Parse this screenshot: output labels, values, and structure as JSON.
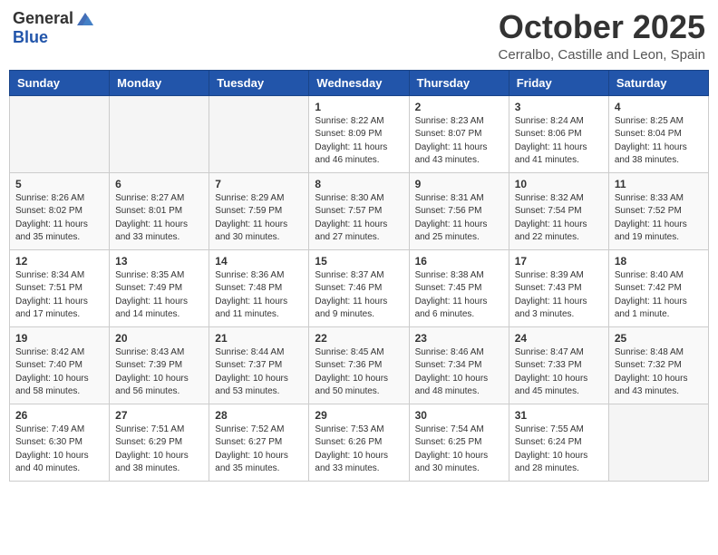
{
  "logo": {
    "text_general": "General",
    "text_blue": "Blue"
  },
  "header": {
    "month": "October 2025",
    "location": "Cerralbo, Castille and Leon, Spain"
  },
  "weekdays": [
    "Sunday",
    "Monday",
    "Tuesday",
    "Wednesday",
    "Thursday",
    "Friday",
    "Saturday"
  ],
  "weeks": [
    [
      {
        "day": "",
        "sunrise": "",
        "sunset": "",
        "daylight": ""
      },
      {
        "day": "",
        "sunrise": "",
        "sunset": "",
        "daylight": ""
      },
      {
        "day": "",
        "sunrise": "",
        "sunset": "",
        "daylight": ""
      },
      {
        "day": "1",
        "sunrise": "Sunrise: 8:22 AM",
        "sunset": "Sunset: 8:09 PM",
        "daylight": "Daylight: 11 hours and 46 minutes."
      },
      {
        "day": "2",
        "sunrise": "Sunrise: 8:23 AM",
        "sunset": "Sunset: 8:07 PM",
        "daylight": "Daylight: 11 hours and 43 minutes."
      },
      {
        "day": "3",
        "sunrise": "Sunrise: 8:24 AM",
        "sunset": "Sunset: 8:06 PM",
        "daylight": "Daylight: 11 hours and 41 minutes."
      },
      {
        "day": "4",
        "sunrise": "Sunrise: 8:25 AM",
        "sunset": "Sunset: 8:04 PM",
        "daylight": "Daylight: 11 hours and 38 minutes."
      }
    ],
    [
      {
        "day": "5",
        "sunrise": "Sunrise: 8:26 AM",
        "sunset": "Sunset: 8:02 PM",
        "daylight": "Daylight: 11 hours and 35 minutes."
      },
      {
        "day": "6",
        "sunrise": "Sunrise: 8:27 AM",
        "sunset": "Sunset: 8:01 PM",
        "daylight": "Daylight: 11 hours and 33 minutes."
      },
      {
        "day": "7",
        "sunrise": "Sunrise: 8:29 AM",
        "sunset": "Sunset: 7:59 PM",
        "daylight": "Daylight: 11 hours and 30 minutes."
      },
      {
        "day": "8",
        "sunrise": "Sunrise: 8:30 AM",
        "sunset": "Sunset: 7:57 PM",
        "daylight": "Daylight: 11 hours and 27 minutes."
      },
      {
        "day": "9",
        "sunrise": "Sunrise: 8:31 AM",
        "sunset": "Sunset: 7:56 PM",
        "daylight": "Daylight: 11 hours and 25 minutes."
      },
      {
        "day": "10",
        "sunrise": "Sunrise: 8:32 AM",
        "sunset": "Sunset: 7:54 PM",
        "daylight": "Daylight: 11 hours and 22 minutes."
      },
      {
        "day": "11",
        "sunrise": "Sunrise: 8:33 AM",
        "sunset": "Sunset: 7:52 PM",
        "daylight": "Daylight: 11 hours and 19 minutes."
      }
    ],
    [
      {
        "day": "12",
        "sunrise": "Sunrise: 8:34 AM",
        "sunset": "Sunset: 7:51 PM",
        "daylight": "Daylight: 11 hours and 17 minutes."
      },
      {
        "day": "13",
        "sunrise": "Sunrise: 8:35 AM",
        "sunset": "Sunset: 7:49 PM",
        "daylight": "Daylight: 11 hours and 14 minutes."
      },
      {
        "day": "14",
        "sunrise": "Sunrise: 8:36 AM",
        "sunset": "Sunset: 7:48 PM",
        "daylight": "Daylight: 11 hours and 11 minutes."
      },
      {
        "day": "15",
        "sunrise": "Sunrise: 8:37 AM",
        "sunset": "Sunset: 7:46 PM",
        "daylight": "Daylight: 11 hours and 9 minutes."
      },
      {
        "day": "16",
        "sunrise": "Sunrise: 8:38 AM",
        "sunset": "Sunset: 7:45 PM",
        "daylight": "Daylight: 11 hours and 6 minutes."
      },
      {
        "day": "17",
        "sunrise": "Sunrise: 8:39 AM",
        "sunset": "Sunset: 7:43 PM",
        "daylight": "Daylight: 11 hours and 3 minutes."
      },
      {
        "day": "18",
        "sunrise": "Sunrise: 8:40 AM",
        "sunset": "Sunset: 7:42 PM",
        "daylight": "Daylight: 11 hours and 1 minute."
      }
    ],
    [
      {
        "day": "19",
        "sunrise": "Sunrise: 8:42 AM",
        "sunset": "Sunset: 7:40 PM",
        "daylight": "Daylight: 10 hours and 58 minutes."
      },
      {
        "day": "20",
        "sunrise": "Sunrise: 8:43 AM",
        "sunset": "Sunset: 7:39 PM",
        "daylight": "Daylight: 10 hours and 56 minutes."
      },
      {
        "day": "21",
        "sunrise": "Sunrise: 8:44 AM",
        "sunset": "Sunset: 7:37 PM",
        "daylight": "Daylight: 10 hours and 53 minutes."
      },
      {
        "day": "22",
        "sunrise": "Sunrise: 8:45 AM",
        "sunset": "Sunset: 7:36 PM",
        "daylight": "Daylight: 10 hours and 50 minutes."
      },
      {
        "day": "23",
        "sunrise": "Sunrise: 8:46 AM",
        "sunset": "Sunset: 7:34 PM",
        "daylight": "Daylight: 10 hours and 48 minutes."
      },
      {
        "day": "24",
        "sunrise": "Sunrise: 8:47 AM",
        "sunset": "Sunset: 7:33 PM",
        "daylight": "Daylight: 10 hours and 45 minutes."
      },
      {
        "day": "25",
        "sunrise": "Sunrise: 8:48 AM",
        "sunset": "Sunset: 7:32 PM",
        "daylight": "Daylight: 10 hours and 43 minutes."
      }
    ],
    [
      {
        "day": "26",
        "sunrise": "Sunrise: 7:49 AM",
        "sunset": "Sunset: 6:30 PM",
        "daylight": "Daylight: 10 hours and 40 minutes."
      },
      {
        "day": "27",
        "sunrise": "Sunrise: 7:51 AM",
        "sunset": "Sunset: 6:29 PM",
        "daylight": "Daylight: 10 hours and 38 minutes."
      },
      {
        "day": "28",
        "sunrise": "Sunrise: 7:52 AM",
        "sunset": "Sunset: 6:27 PM",
        "daylight": "Daylight: 10 hours and 35 minutes."
      },
      {
        "day": "29",
        "sunrise": "Sunrise: 7:53 AM",
        "sunset": "Sunset: 6:26 PM",
        "daylight": "Daylight: 10 hours and 33 minutes."
      },
      {
        "day": "30",
        "sunrise": "Sunrise: 7:54 AM",
        "sunset": "Sunset: 6:25 PM",
        "daylight": "Daylight: 10 hours and 30 minutes."
      },
      {
        "day": "31",
        "sunrise": "Sunrise: 7:55 AM",
        "sunset": "Sunset: 6:24 PM",
        "daylight": "Daylight: 10 hours and 28 minutes."
      },
      {
        "day": "",
        "sunrise": "",
        "sunset": "",
        "daylight": ""
      }
    ]
  ]
}
